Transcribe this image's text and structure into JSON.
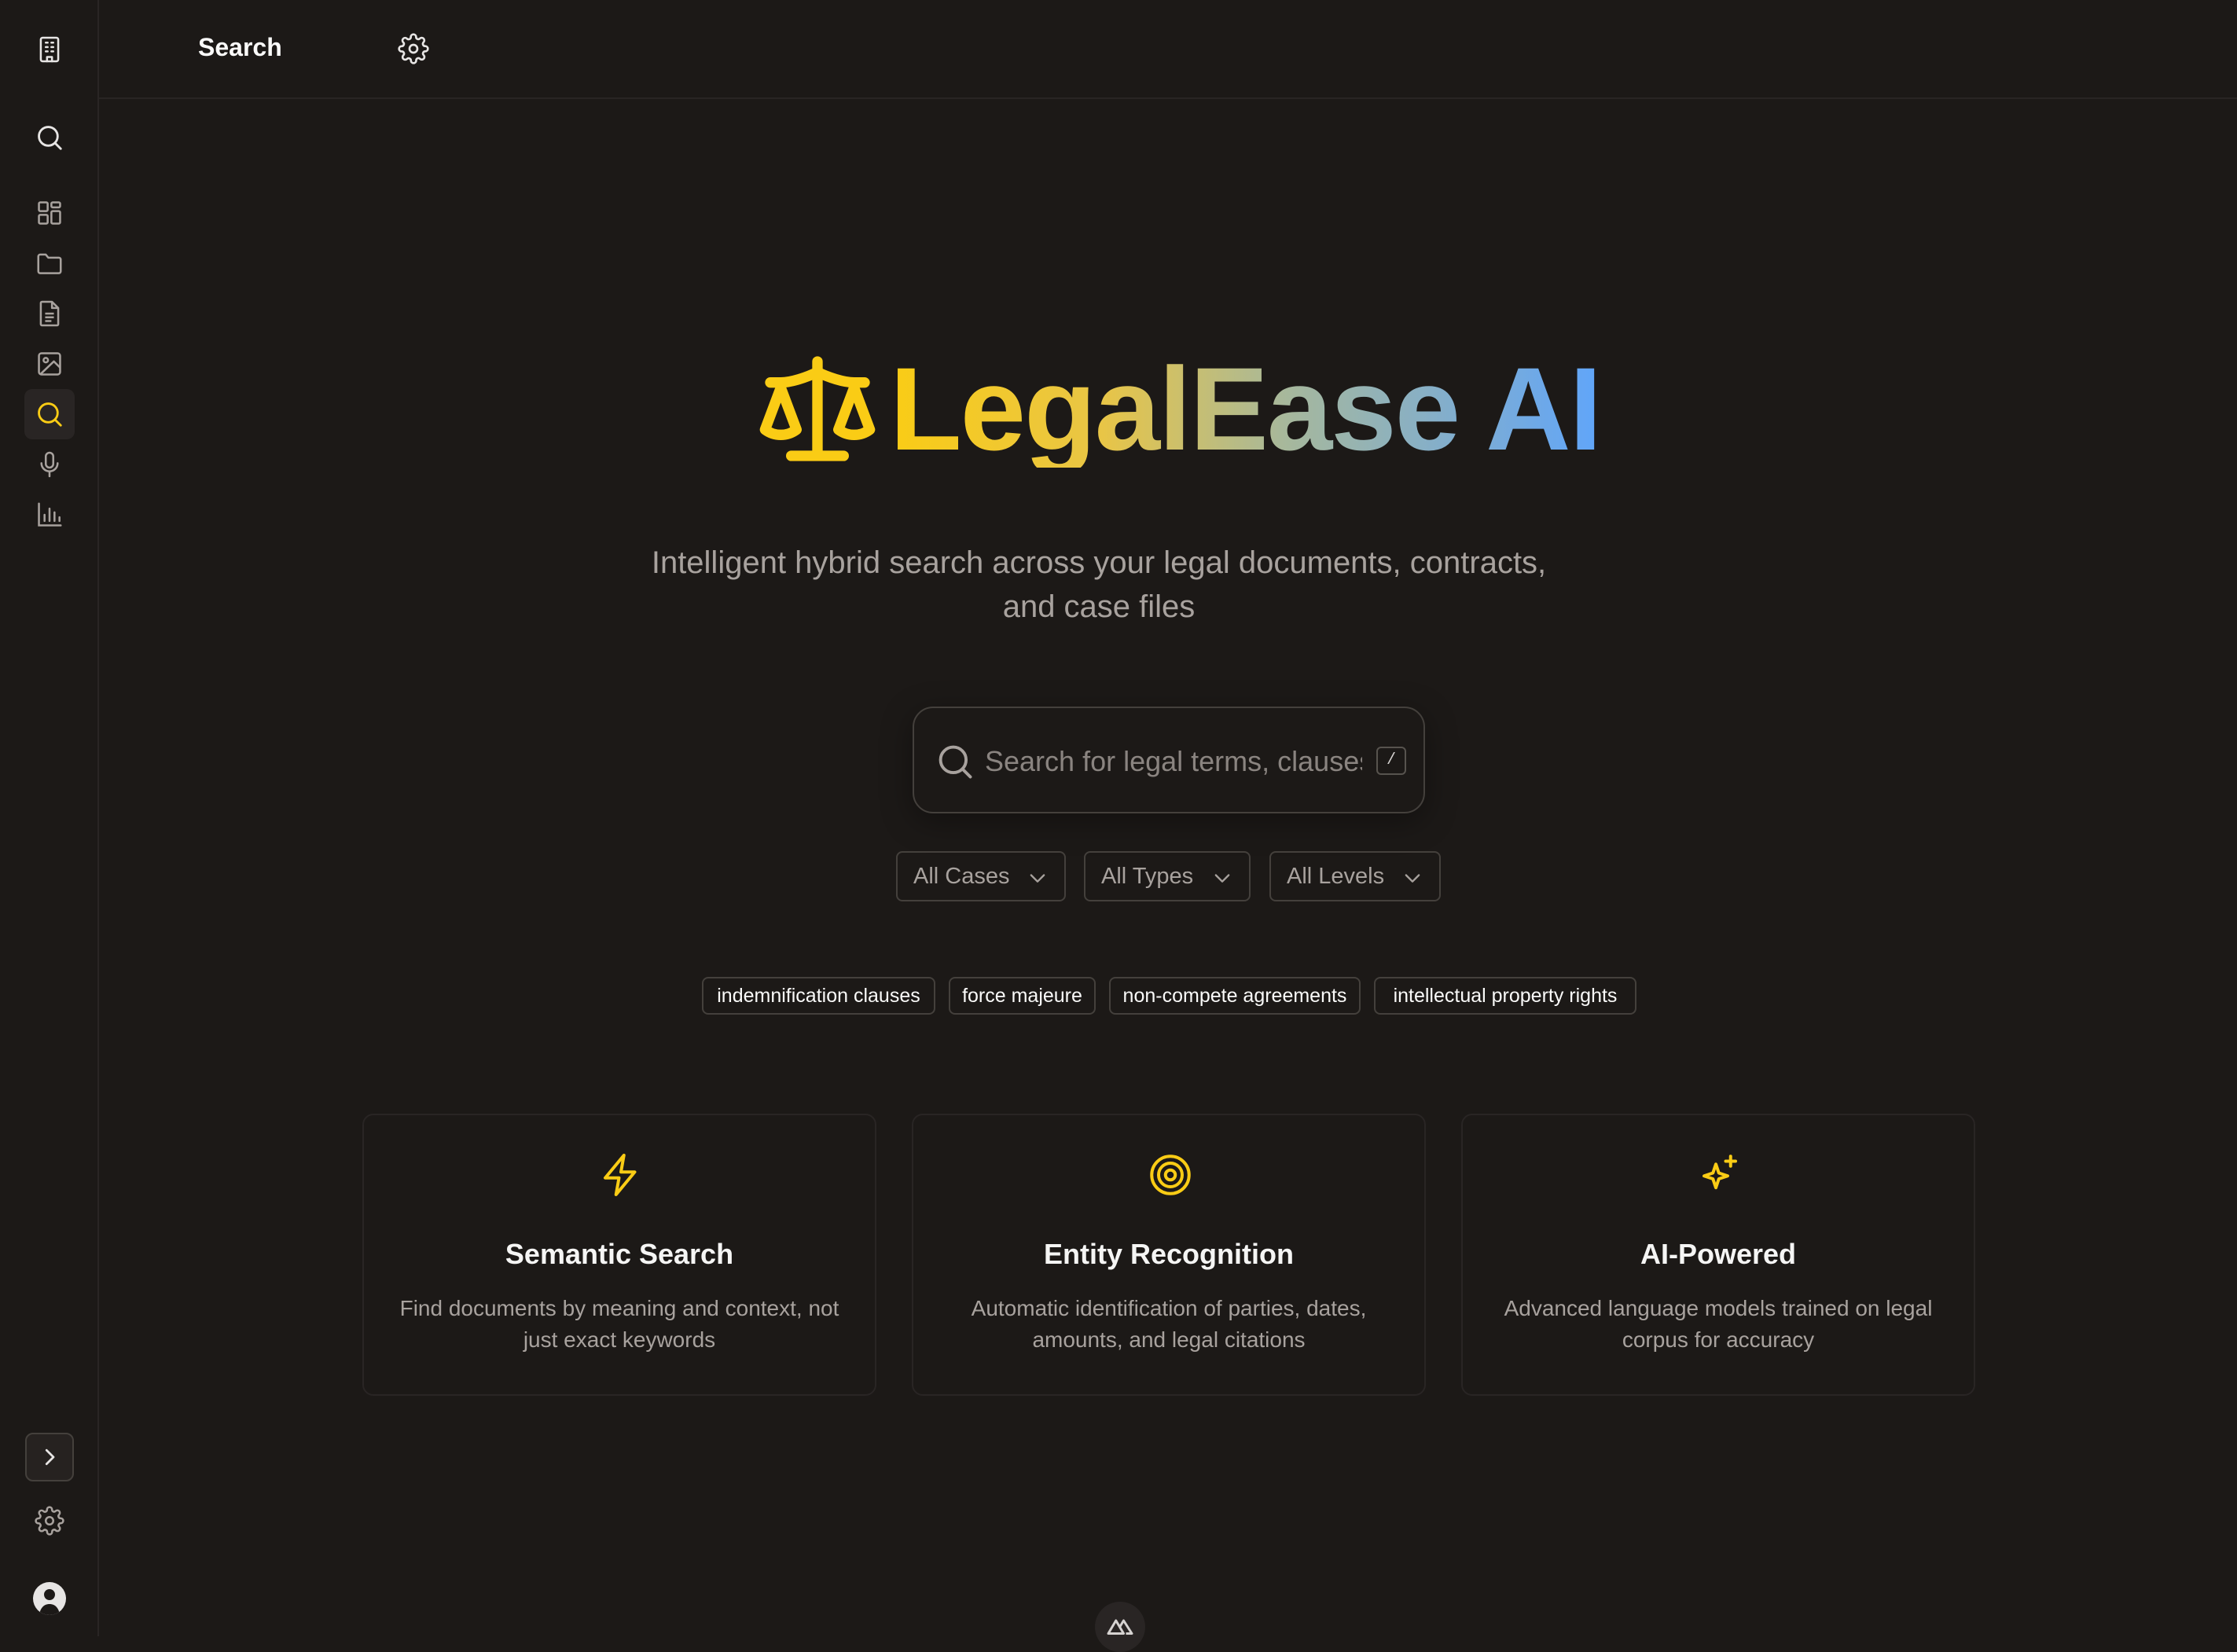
{
  "header": {
    "title": "Search"
  },
  "sidebar": {
    "items": [
      {
        "icon": "building-icon"
      },
      {
        "icon": "search-icon"
      },
      {
        "icon": "dashboard-icon"
      },
      {
        "icon": "folder-icon"
      },
      {
        "icon": "document-icon"
      },
      {
        "icon": "image-icon"
      },
      {
        "icon": "search-icon",
        "active": true
      },
      {
        "icon": "microphone-icon"
      },
      {
        "icon": "bar-chart-icon"
      }
    ],
    "bottom": [
      {
        "icon": "chevron-right-icon"
      },
      {
        "icon": "gear-icon"
      },
      {
        "icon": "avatar"
      }
    ]
  },
  "hero": {
    "brand": "LegalEase AI",
    "tagline": "Intelligent hybrid search across your legal documents, contracts, and case files"
  },
  "search": {
    "placeholder": "Search for legal terms, clauses",
    "shortcut": "/"
  },
  "filters": [
    "All Cases",
    "All Types",
    "All Levels"
  ],
  "suggestions": [
    "indemnification clauses",
    "force majeure",
    "non-compete agreements",
    "intellectual property rights"
  ],
  "features": [
    {
      "icon": "lightning-icon",
      "title": "Semantic Search",
      "desc": "Find documents by meaning and context, not just exact keywords"
    },
    {
      "icon": "target-icon",
      "title": "Entity Recognition",
      "desc": "Automatic identification of parties, dates, amounts, and legal citations"
    },
    {
      "icon": "sparkles-icon",
      "title": "AI-Powered",
      "desc": "Advanced language models trained on legal corpus for accuracy"
    }
  ],
  "colors": {
    "accent": "#facc15",
    "brand_end": "#60a5fa",
    "background": "#1c1917"
  }
}
